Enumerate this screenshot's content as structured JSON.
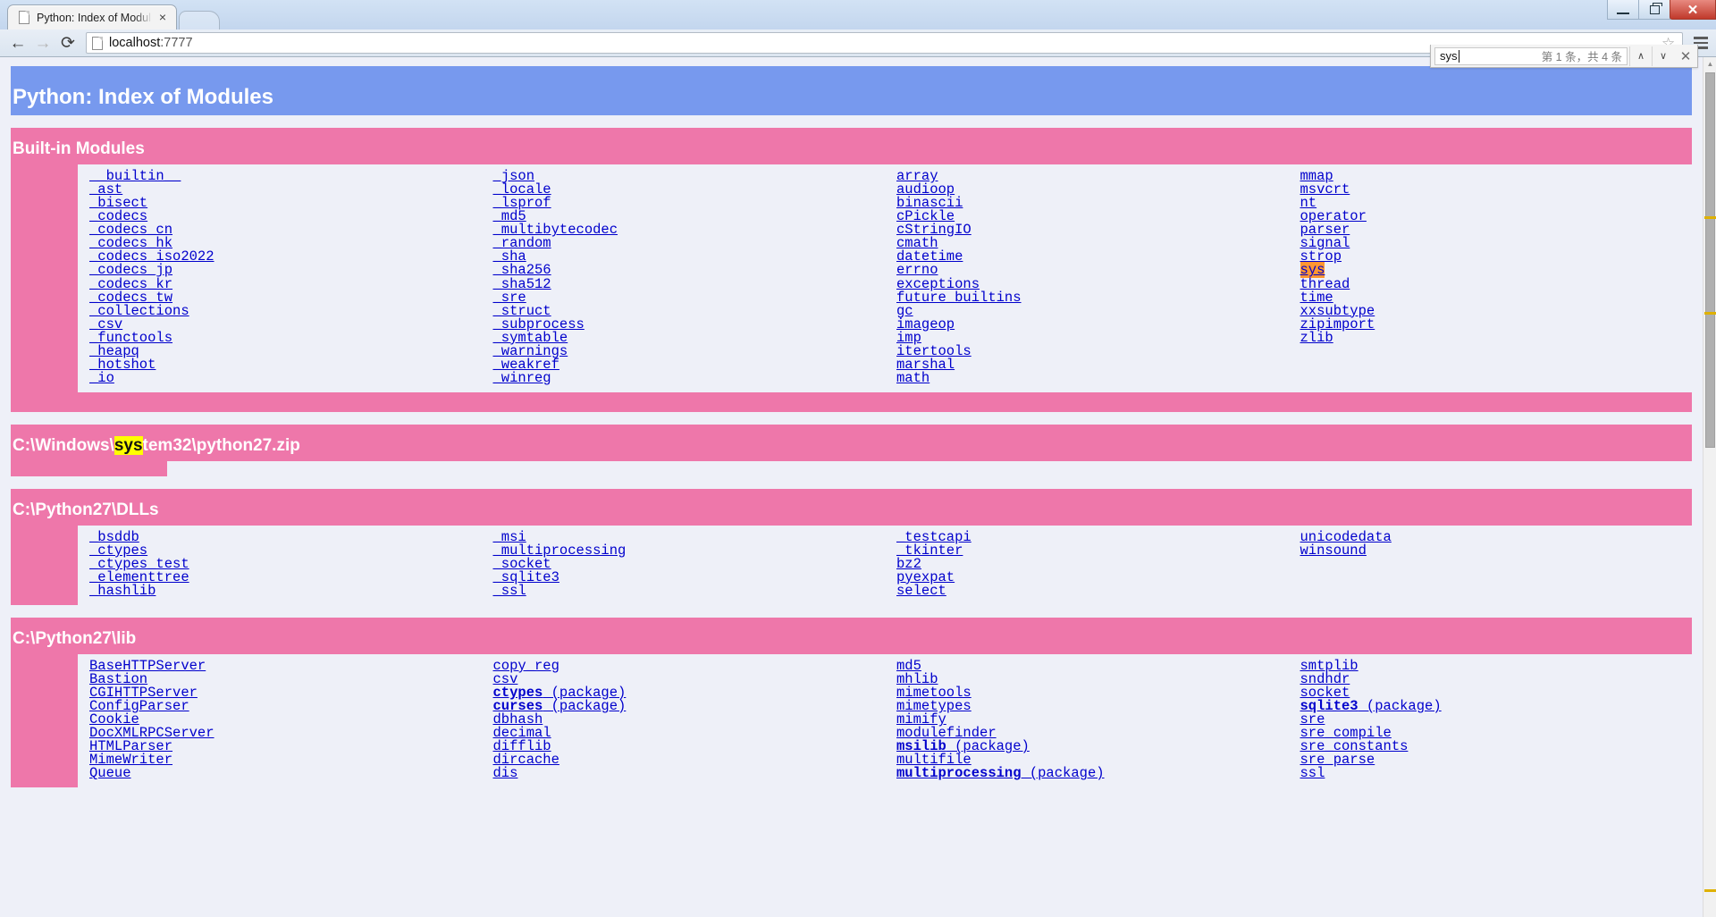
{
  "browser": {
    "tab_title": "Python: Index of Modul",
    "tab_close_glyph": "×",
    "back_glyph": "←",
    "forward_glyph": "→",
    "reload_glyph": "⟳",
    "url_host": "localhost",
    "url_rest": ":7777",
    "star_glyph": "☆",
    "window_close_glyph": "✕"
  },
  "findbar": {
    "query": "sys",
    "count_label": "第 1 条，共 4 条",
    "prev_glyph": "∧",
    "next_glyph": "∨",
    "close_glyph": "✕"
  },
  "page": {
    "banner_title": "Python: Index of Modules",
    "sections": [
      {
        "id": "builtin",
        "title": "Built-in Modules",
        "title_parts": [
          {
            "text": "Built-in Modules",
            "hl": "none"
          }
        ],
        "columns": [
          [
            "__builtin__",
            "_ast",
            "_bisect",
            "_codecs",
            "_codecs_cn",
            "_codecs_hk",
            "_codecs_iso2022",
            "_codecs_jp",
            "_codecs_kr",
            "_codecs_tw",
            "_collections",
            "_csv",
            "_functools",
            "_heapq",
            "_hotshot",
            "_io"
          ],
          [
            "_json",
            "_locale",
            "_lsprof",
            "_md5",
            "_multibytecodec",
            "_random",
            "_sha",
            "_sha256",
            "_sha512",
            "_sre",
            "_struct",
            "_subprocess",
            "_symtable",
            "_warnings",
            "_weakref",
            "_winreg"
          ],
          [
            "array",
            "audioop",
            "binascii",
            "cPickle",
            "cStringIO",
            "cmath",
            "datetime",
            "errno",
            "exceptions",
            "future_builtins",
            "gc",
            "imageop",
            "imp",
            "itertools",
            "marshal",
            "math"
          ],
          [
            "mmap",
            "msvcrt",
            "nt",
            "operator",
            "parser",
            "signal",
            "strop",
            "sys",
            "thread",
            "time",
            "xxsubtype",
            "zipimport",
            "zlib"
          ]
        ],
        "active_match": "sys"
      },
      {
        "id": "zip",
        "title": "C:\\Windows\\system32\\python27.zip",
        "title_parts": [
          {
            "text": "C:\\Windows\\",
            "hl": "none"
          },
          {
            "text": "sys",
            "hl": "find"
          },
          {
            "text": "tem32\\python27.zip",
            "hl": "none"
          }
        ],
        "columns": [
          [],
          [],
          [],
          []
        ]
      },
      {
        "id": "dlls",
        "title": "C:\\Python27\\DLLs",
        "title_parts": [
          {
            "text": "C:\\Python27\\DLLs",
            "hl": "none"
          }
        ],
        "columns": [
          [
            "_bsddb",
            "_ctypes",
            "_ctypes_test",
            "_elementtree",
            "_hashlib"
          ],
          [
            "_msi",
            "_multiprocessing",
            "_socket",
            "_sqlite3",
            "_ssl"
          ],
          [
            "_testcapi",
            "_tkinter",
            "bz2",
            "pyexpat",
            "select"
          ],
          [
            "unicodedata",
            "winsound"
          ]
        ]
      },
      {
        "id": "lib",
        "title": "C:\\Python27\\lib",
        "title_parts": [
          {
            "text": "C:\\Python27\\lib",
            "hl": "none"
          }
        ],
        "columns": [
          [
            "BaseHTTPServer",
            "Bastion",
            "CGIHTTPServer",
            "ConfigParser",
            "Cookie",
            "DocXMLRPCServer",
            "HTMLParser",
            "MimeWriter",
            "Queue"
          ],
          [
            "copy_reg",
            "csv",
            "ctypes (package)",
            "curses (package)",
            "dbhash",
            "decimal",
            "difflib",
            "dircache",
            "dis"
          ],
          [
            "md5",
            "mhlib",
            "mimetools",
            "mimetypes",
            "mimify",
            "modulefinder",
            "msilib (package)",
            "multifile",
            "multiprocessing (package)"
          ],
          [
            "smtplib",
            "sndhdr",
            "socket",
            "sqlite3 (package)",
            "sre",
            "sre_compile",
            "sre_constants",
            "sre_parse",
            "ssl"
          ]
        ]
      }
    ]
  },
  "scrollbar": {
    "up_glyph": "▲",
    "tick_positions": [
      178,
      285,
      931
    ]
  },
  "colors": {
    "banner_blue": "#7799ee",
    "section_pink": "#ee77aa",
    "page_bg": "#eef0f8",
    "link_blue": "#0000cc",
    "active_find": "#ff9632",
    "find_highlight": "#ffff00"
  }
}
